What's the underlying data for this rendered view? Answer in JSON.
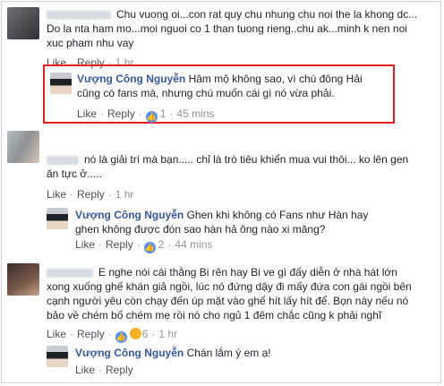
{
  "comments": [
    {
      "text": "Chu vuong oi...con rat quy chu nhung chu noi the la khong dc... Do la nta ham mo...moi nguoi co 1 than tuong rieng..chu ak...minh k nen noi xuc pham nhu vay",
      "actions": {
        "like": "Like",
        "reply": "Reply",
        "time": "1 hr"
      }
    },
    {
      "author": "Vượng Công Nguyễn",
      "text": "Hâm mộ không sao, vì chú đông Hải cũng có fans mà, nhưng chú muốn cái gì nó vừa phải.",
      "actions": {
        "like": "Like",
        "reply": "Reply",
        "likes": "1",
        "time": "45 mins"
      }
    },
    {
      "text": "nó là giải trí mà bạn..... chỉ là trò tiêu khiển mua vui thôi... ko lên gen ăn tực ở.....",
      "actions": {
        "like": "Like",
        "reply": "Reply",
        "time": "1 hr"
      }
    },
    {
      "author": "Vượng Công Nguyễn",
      "text": "Ghen khi không có Fans như Hàn hay ghen không được đón sao hàn hả ông nào xi măng?",
      "actions": {
        "like": "Like",
        "reply": "Reply",
        "likes": "2",
        "time": "44 mins"
      }
    },
    {
      "text": "E nghe nói cái thằng Bi rên hay Bi ve gì đấy diễn ở nhà hát lớn xong xuống ghế khán giả ngồi, lúc nó đứng dậy đi mấy đứa con gái ngồi bên cạnh người yêu còn chạy đến úp mặt vào ghế hít lấy hít để. Bọn này nếu nó bảo về chém bố chém mẹ rồi nó cho ngủ 1 đêm chắc cũng k phải nghĩ",
      "actions": {
        "like": "Like",
        "reply": "Reply",
        "reactions": "6",
        "time": "1 hr"
      }
    },
    {
      "author": "Vượng Công Nguyễn",
      "text": "Chán lắm ý em ạ!",
      "actions": {
        "like": "Like",
        "reply": "Reply"
      }
    }
  ],
  "colors": {
    "author": "#365899",
    "highlight": "#e02020",
    "like_badge": "#5890ff"
  }
}
